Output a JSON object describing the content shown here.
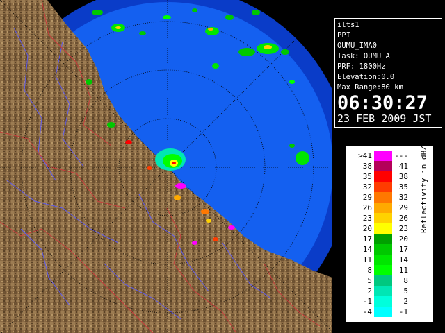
{
  "info_panel": {
    "station": "ilts1",
    "product": "PPI",
    "site_code": "OUMU_IMA0",
    "task": "Task: OUMU_A",
    "prf": "PRF: 1800Hz",
    "elevation": "Elevation:0.0",
    "max_range": "Max Range:80 km",
    "time": "06:30:27",
    "date": "23 FEB 2009 JST"
  },
  "legend": {
    "unit_label": "Reflectivity in dBZ",
    "rows": [
      {
        "lo": ">41",
        "hi": "---",
        "color": "#ff00ff"
      },
      {
        "lo": "38",
        "hi": "41",
        "color": "#b4005a"
      },
      {
        "lo": "35",
        "hi": "38",
        "color": "#ff0000"
      },
      {
        "lo": "32",
        "hi": "35",
        "color": "#ff3c00"
      },
      {
        "lo": "29",
        "hi": "32",
        "color": "#ff7800"
      },
      {
        "lo": "26",
        "hi": "29",
        "color": "#ffaa00"
      },
      {
        "lo": "23",
        "hi": "26",
        "color": "#ffd200"
      },
      {
        "lo": "20",
        "hi": "23",
        "color": "#ffff00"
      },
      {
        "lo": "17",
        "hi": "20",
        "color": "#00a000"
      },
      {
        "lo": "14",
        "hi": "17",
        "color": "#00c800"
      },
      {
        "lo": "11",
        "hi": "14",
        "color": "#00e600"
      },
      {
        "lo": "8",
        "hi": "11",
        "color": "#00ff00"
      },
      {
        "lo": "5",
        "hi": "8",
        "color": "#00c880"
      },
      {
        "lo": "2",
        "hi": "5",
        "color": "#00e6b4"
      },
      {
        "lo": "-1",
        "hi": "2",
        "color": "#00ffdc"
      },
      {
        "lo": "-4",
        "hi": "-1",
        "color": "#00ffff"
      }
    ]
  },
  "colors": {
    "sea": "#1460f0",
    "outer_sea": "#0a3cc8",
    "land": "#8a6a44",
    "river": "#5a5aff",
    "border": "#c83c3c",
    "grid": "#000000"
  }
}
